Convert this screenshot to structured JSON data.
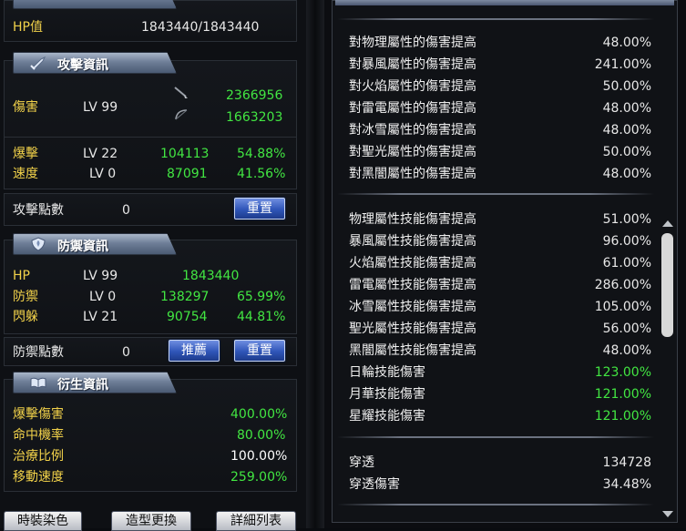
{
  "left": {
    "hp_label": "HP值",
    "hp_value": "1843440/1843440",
    "attack": {
      "title": "攻擊資訊",
      "damage_label": "傷害",
      "damage_lv": "LV 99",
      "damage_val1": "2366956",
      "damage_val2": "1663203",
      "crit_label": "爆擊",
      "crit_lv": "LV 22",
      "crit_val": "104113",
      "crit_pct": "54.88%",
      "speed_label": "速度",
      "speed_lv": "LV 0",
      "speed_val": "87091",
      "speed_pct": "41.56%",
      "points_label": "攻擊點數",
      "points_val": "0",
      "reset_label": "重置"
    },
    "defense": {
      "title": "防禦資訊",
      "hp_label": "HP",
      "hp_lv": "LV 99",
      "hp_val": "1843440",
      "def_label": "防禦",
      "def_lv": "LV 0",
      "def_val": "138297",
      "def_pct": "65.99%",
      "eva_label": "閃躲",
      "eva_lv": "LV 21",
      "eva_val": "90754",
      "eva_pct": "44.81%",
      "points_label": "防禦點數",
      "points_val": "0",
      "recommend_label": "推薦",
      "reset_label": "重置"
    },
    "derived": {
      "title": "衍生資訊",
      "rows": [
        {
          "label": "爆擊傷害",
          "value": "400.00%"
        },
        {
          "label": "命中機率",
          "value": "80.00%"
        },
        {
          "label": "治療比例",
          "value": "100.00%"
        },
        {
          "label": "移動速度",
          "value": "259.00%"
        }
      ]
    },
    "bottom_buttons": [
      "時裝染色",
      "造型更換",
      "詳細列表"
    ]
  },
  "right": {
    "group1": [
      {
        "label": "對物理屬性的傷害提高",
        "value": "48.00%"
      },
      {
        "label": "對暴風屬性的傷害提高",
        "value": "241.00%"
      },
      {
        "label": "對火焰屬性的傷害提高",
        "value": "50.00%"
      },
      {
        "label": "對雷電屬性的傷害提高",
        "value": "48.00%"
      },
      {
        "label": "對冰雪屬性的傷害提高",
        "value": "48.00%"
      },
      {
        "label": "對聖光屬性的傷害提高",
        "value": "50.00%"
      },
      {
        "label": "對黑闇屬性的傷害提高",
        "value": "48.00%"
      }
    ],
    "group2": [
      {
        "label": "物理屬性技能傷害提高",
        "value": "51.00%"
      },
      {
        "label": "暴風屬性技能傷害提高",
        "value": "96.00%"
      },
      {
        "label": "火焰屬性技能傷害提高",
        "value": "61.00%"
      },
      {
        "label": "雷電屬性技能傷害提高",
        "value": "286.00%"
      },
      {
        "label": "冰雪屬性技能傷害提高",
        "value": "105.00%"
      },
      {
        "label": "聖光屬性技能傷害提高",
        "value": "56.00%"
      },
      {
        "label": "黑闇屬性技能傷害提高",
        "value": "48.00%"
      },
      {
        "label": "日輪技能傷害",
        "value": "123.00%"
      },
      {
        "label": "月華技能傷害",
        "value": "121.00%"
      },
      {
        "label": "星耀技能傷害",
        "value": "121.00%"
      }
    ],
    "group3": [
      {
        "label": "穿透",
        "value": "134728"
      },
      {
        "label": "穿透傷害",
        "value": "34.48%"
      }
    ]
  },
  "colors": {
    "label_yellow": "#f2d24a",
    "value_green": "#42e642",
    "button_blue": "#2f55b8"
  }
}
